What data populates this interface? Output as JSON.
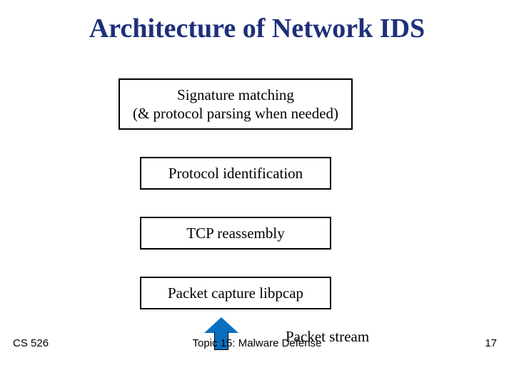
{
  "title": "Architecture of Network IDS",
  "boxes": {
    "sig_line1": "Signature matching",
    "sig_line2": "(& protocol parsing when needed)",
    "protocol": "Protocol identification",
    "tcp": "TCP reassembly",
    "pcap": "Packet capture libpcap"
  },
  "stream_label": "Packet stream",
  "footer": {
    "course": "CS 526",
    "topic": "Topic 15: Malware Defense",
    "page": "17"
  }
}
